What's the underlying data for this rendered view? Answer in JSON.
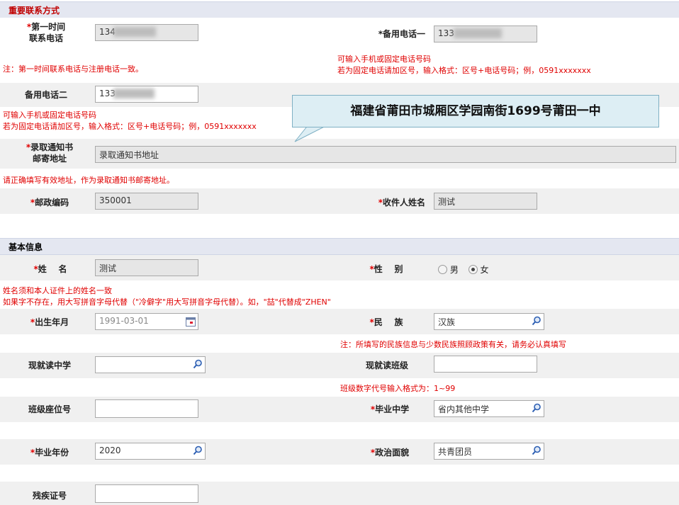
{
  "contact": {
    "title": "重要联系方式",
    "phone1_label": "*第一时间联系电话",
    "phone1_value": "134",
    "phone_main_label": "*备用电话一",
    "phone_main_value": "133",
    "note_phone1": "注：第一时间联系电话与注册电话一致。",
    "note_main_1": "可输入手机或固定电话号码",
    "note_main_2": "若为固定电话请加区号，输入格式：区号+电话号码；例，0591xxxxxxx",
    "phone2_label": "备用电话二",
    "phone2_value": "133",
    "note_phone2_1": "可输入手机或固定电话号码",
    "note_phone2_2": "若为固定电话请加区号，输入格式：区号+电话号码；例，0591xxxxxxx",
    "address_label": "*录取通知书邮寄地址",
    "address_value": "录取通知书地址",
    "note_address": "请正确填写有效地址，作为录取通知书邮寄地址。",
    "postcode_label": "*邮政编码",
    "postcode_value": "350001",
    "receiver_label": "*收件人姓名",
    "receiver_value": "测试"
  },
  "callout_text": "福建省莆田市城厢区学园南街1699号莆田一中",
  "basic": {
    "title": "基本信息",
    "name_label": "*姓    名",
    "name_value": "测试",
    "gender_label": "*性    别",
    "gender_options": [
      "男",
      "女"
    ],
    "gender_selected": "女",
    "note_name_1": "姓名须和本人证件上的姓名一致",
    "note_name_2": "如果字不存在，用大写拼音字母代替（\"冷僻字\"用大写拼音字母代替）。如，\"喆\"代替成\"ZHEN\"",
    "birth_label": "*出生年月",
    "birth_value": "1991-03-01",
    "ethnic_label": "*民    族",
    "ethnic_value": "汉族",
    "note_ethnic": "注：所填写的民族信息与少数民族照顾政策有关，请务必认真填写",
    "school_label": "现就读中学",
    "school_value": "",
    "class_label": "现就读班级",
    "class_value": "",
    "note_class": "班级数字代号输入格式为：1~99",
    "seat_label": "班级座位号",
    "seat_value": "",
    "grad_school_label": "*毕业中学",
    "grad_school_value": "省内其他中学",
    "grad_year_label": "*毕业年份",
    "grad_year_value": "2020",
    "political_label": "*政治面貌",
    "political_value": "共青团员",
    "disability_label": "残疾证号",
    "disability_value": ""
  }
}
